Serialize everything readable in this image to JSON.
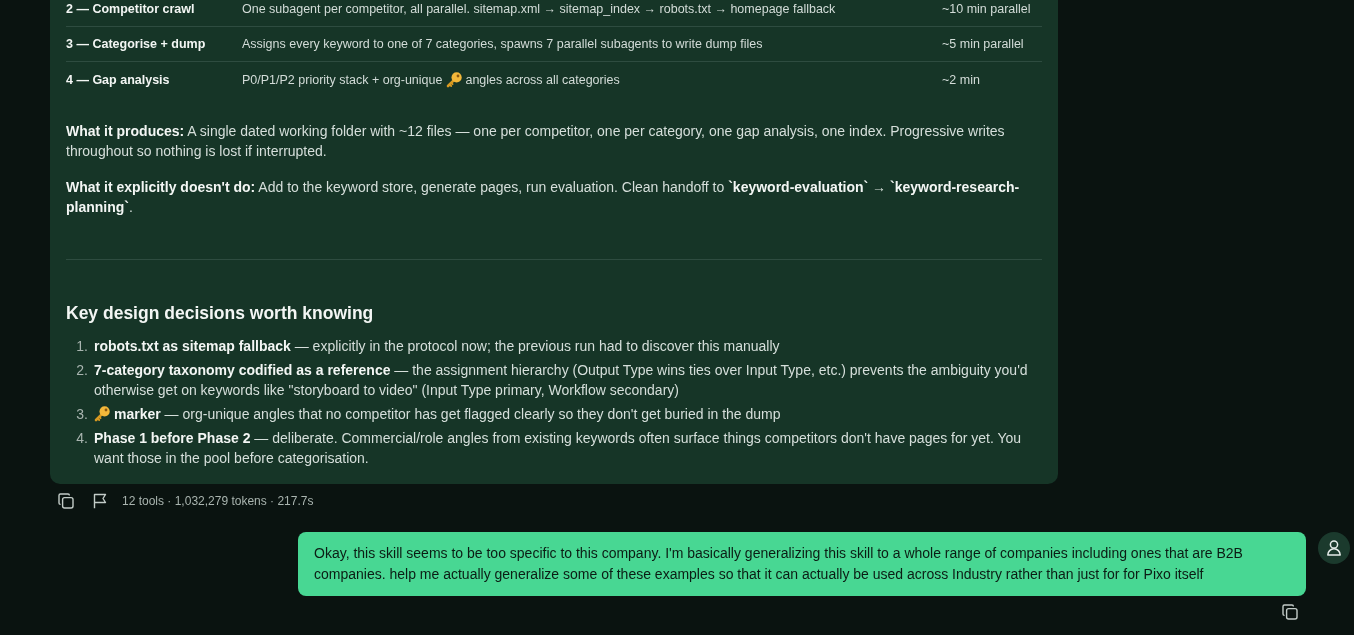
{
  "steps_table": {
    "rows": [
      {
        "step": "2 — Competitor crawl",
        "description": [
          {
            "kind": "text",
            "text": "One subagent per competitor, all parallel. sitemap.xml → sitemap_index → robots.txt → homepage fallback"
          }
        ],
        "duration": "~10 min parallel"
      },
      {
        "step": "3 — Categorise + dump",
        "description": [
          {
            "kind": "text",
            "text": "Assigns every keyword to one of 7 categories, spawns 7 parallel subagents to write dump files"
          }
        ],
        "duration": "~5 min parallel"
      },
      {
        "step": "4 — Gap analysis",
        "description": [
          {
            "kind": "text",
            "text": "P0/P1/P2 priority stack + org-unique"
          },
          {
            "kind": "icon"
          },
          {
            "kind": "text",
            "text": "angles across all categories"
          }
        ],
        "duration": "~2 min"
      }
    ]
  },
  "paragraphs": [
    "**What it produces:** A single dated working folder with ~12 files — one per competitor, one per category, one gap analysis, one index. Progressive writes throughout so nothing is lost if interrupted.",
    "**What it explicitly doesn't do:** Add to the keyword store, generate pages, run evaluation. Clean handoff to **`keyword-evaluation`** → **`keyword-research-planning`**."
  ],
  "section": {
    "heading": "Key design decisions worth knowing",
    "items": [
      {
        "number": "1.",
        "segments": [
          {
            "kind": "text",
            "text": "**robots.txt as sitemap fallback** — explicitly in the protocol now; the previous run had to discover this manually"
          }
        ]
      },
      {
        "number": "2.",
        "segments": [
          {
            "kind": "text",
            "text": "**7-category taxonomy codified as a reference** — the assignment hierarchy (Output Type wins ties over Input Type, etc.) prevents the ambiguity you'd otherwise get on keywords like \"storyboard to video\" (Input Type primary, Workflow secondary)"
          }
        ]
      },
      {
        "number": "3.",
        "segments": [
          {
            "kind": "icon"
          },
          {
            "kind": "text",
            "text": "**marker** — org-unique angles that no competitor has get flagged clearly so they don't get buried in the dump"
          }
        ]
      },
      {
        "number": "4.",
        "segments": [
          {
            "kind": "text",
            "text": "**Phase 1 before Phase 2** — deliberate. Commercial/role angles from existing keywords often surface things competitors don't have pages for yet. You want those in the pool before categorisation."
          }
        ]
      }
    ]
  },
  "message_footer": {
    "stats": "12 tools · 1,032,279 tokens · 217.7s"
  },
  "user_message": {
    "text": "Okay, this skill seems to be too specific to this company. I'm basically generalizing this skill to a whole range of companies including ones that are B2B companies. help me actually generalize some of these examples so that it can actually be used across Industry rather than just for for Pixo itself"
  }
}
